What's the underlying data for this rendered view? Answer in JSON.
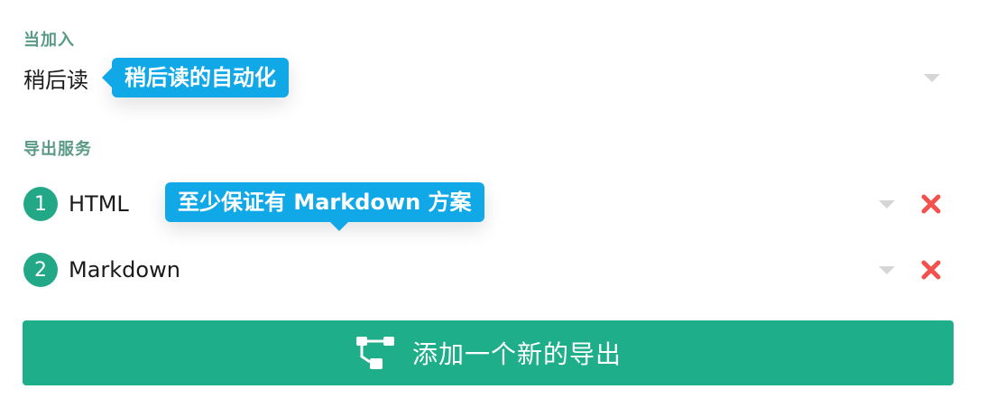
{
  "trigger": {
    "label": "当加入",
    "selected": "稍后读",
    "tooltip": "稍后读的自动化"
  },
  "exports": {
    "label": "导出服务",
    "tooltip": "至少保证有 Markdown 方案",
    "items": [
      {
        "index": "1",
        "name": "HTML"
      },
      {
        "index": "2",
        "name": "Markdown"
      }
    ]
  },
  "add_button": {
    "label": "添加一个新的导出"
  },
  "colors": {
    "accent": "#1eae8a",
    "tooltip": "#11a8e8",
    "section_label": "#5a9a86",
    "remove": "#f2514c"
  },
  "icons": {
    "remove": "close-x-icon",
    "add": "flow-branch-icon",
    "dropdown": "caret-down-icon"
  }
}
